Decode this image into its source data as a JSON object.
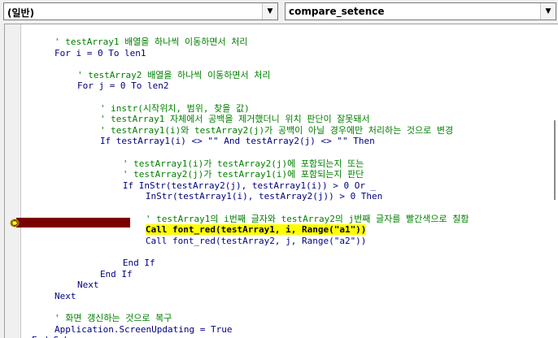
{
  "toolbar": {
    "object_combo": "(일반)",
    "procedure_combo": "compare_setence"
  },
  "code_lines": [
    {
      "indent": 4,
      "text": "' testArray1 배열을 하나씩 이동하면서 처리",
      "kind": "comment"
    },
    {
      "indent": 4,
      "text": "For i = 0 To len1",
      "kind": "default"
    },
    {
      "indent": 0,
      "text": "",
      "kind": "default"
    },
    {
      "indent": 8,
      "text": "' testArray2 배열을 하나씩 이동하면서 처리",
      "kind": "comment"
    },
    {
      "indent": 8,
      "text": "For j = 0 To len2",
      "kind": "default"
    },
    {
      "indent": 0,
      "text": "",
      "kind": "default"
    },
    {
      "indent": 12,
      "text": "' instr(시작위치, 범위, 찾을 값)",
      "kind": "comment"
    },
    {
      "indent": 12,
      "text": "' testArray1 자체에서 공백을 제거했더니 위치 판단이 잘못돼서",
      "kind": "comment"
    },
    {
      "indent": 12,
      "text": "' testArray1(i)와 testArray2(j)가 공백이 아닐 경우에만 처리하는 것으로 변경",
      "kind": "comment"
    },
    {
      "indent": 12,
      "text": "If testArray1(i) <> \"\" And testArray2(j) <> \"\" Then",
      "kind": "default"
    },
    {
      "indent": 0,
      "text": "",
      "kind": "default"
    },
    {
      "indent": 16,
      "text": "' testArray1(i)가 testArray2(j)에 포함되는지 또는",
      "kind": "comment"
    },
    {
      "indent": 16,
      "text": "' testArray2(j)가 testArray1(i)에 포함되는지 판단",
      "kind": "comment"
    },
    {
      "indent": 16,
      "text": "If InStr(testArray2(j), testArray1(i)) > 0 Or _",
      "kind": "default"
    },
    {
      "indent": 20,
      "text": "InStr(testArray1(i), testArray2(j)) > 0 Then",
      "kind": "default"
    },
    {
      "indent": 0,
      "text": "",
      "kind": "default"
    },
    {
      "indent": 20,
      "text": "' testArray1의 i번째 글자와 testArray2의 j번째 글자를 빨간색으로 칠함",
      "kind": "comment"
    },
    {
      "indent": 20,
      "text": "Call font_red(testArray1, i, Range(\"a1\"))",
      "kind": "highlight"
    },
    {
      "indent": 20,
      "text": "Call font_red(testArray2, j, Range(\"a2\"))",
      "kind": "default"
    },
    {
      "indent": 0,
      "text": "",
      "kind": "default"
    },
    {
      "indent": 16,
      "text": "End If",
      "kind": "default"
    },
    {
      "indent": 12,
      "text": "End If",
      "kind": "default"
    },
    {
      "indent": 8,
      "text": "Next",
      "kind": "default"
    },
    {
      "indent": 4,
      "text": "Next",
      "kind": "default"
    },
    {
      "indent": 0,
      "text": "",
      "kind": "default"
    },
    {
      "indent": 4,
      "text": "' 화면 갱신하는 것으로 복구",
      "kind": "comment"
    },
    {
      "indent": 4,
      "text": "Application.ScreenUpdating = True",
      "kind": "default"
    },
    {
      "indent": 0,
      "text": "End Sub",
      "kind": "default"
    }
  ],
  "colors": {
    "comment": "#008000",
    "keyword": "#000080",
    "execution_highlight": "#ffff00",
    "execution_bar": "#7b0000"
  },
  "icons": {
    "execution_pointer": "yellow-arrow-icon"
  }
}
